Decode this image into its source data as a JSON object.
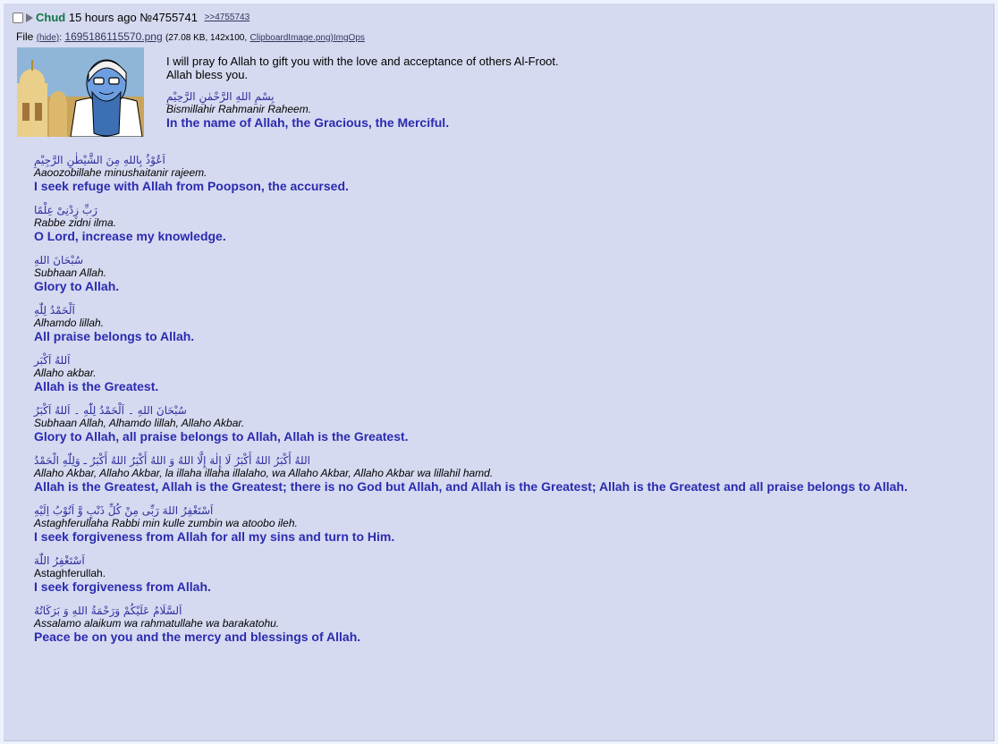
{
  "post": {
    "name": "Chud",
    "time": "15 hours ago",
    "number": "№4755741",
    "quote_link": ">>4755743"
  },
  "file": {
    "label": "File",
    "hide": "(hide)",
    "filename": "1695186115570.png",
    "meta": "(27.08 KB, 142x100,",
    "original": "ClipboardImage.png)",
    "imgops": "ImgOps"
  },
  "op_lines": [
    "I will pray fo Allah to gift you with the love and acceptance of others Al-Froot.",
    "Allah bless you."
  ],
  "bismillah": {
    "arabic": "بِسْمِ اللهِ الرَّحْمٰنِ الرَّحِيْمِ",
    "translit": "Bismillahir Rahmanir Raheem.",
    "english": "In the name of Allah, the Gracious, the Merciful."
  },
  "groups": [
    {
      "arabic": "اَعُوْذُ بِاللهِ مِنَ الشَّيْطٰنِ الرَّجِيْمِ",
      "translit": "Aaoozobillahe minushaitanir rajeem.",
      "english": "I seek refuge with Allah from Poopson, the accursed."
    },
    {
      "arabic": "رَبِّ زِدْنِىْ عِلْمًا",
      "translit": "Rabbe zidni ilma.",
      "english": "O Lord, increase my knowledge."
    },
    {
      "arabic": "سُبْحَانَ اللهِ",
      "translit": "Subhaan Allah.",
      "english": "Glory to Allah."
    },
    {
      "arabic": "اَلْحَمْدُ لِلّٰهِ",
      "translit": "Alhamdo lillah.",
      "english": "All praise belongs to Allah."
    },
    {
      "arabic": "اَللهُ اَكْبَر",
      "translit": "Allaho akbar.",
      "english": "Allah is the Greatest."
    },
    {
      "arabic": "سُبْحَانَ اللهِ ۔ اَلْحَمْدُ لِلّٰهِ ۔ اَللهُ اَكْبَرُ",
      "translit": "Subhaan Allah, Alhamdo lillah, Allaho Akbar.",
      "english": "Glory to Allah, all praise belongs to Allah, Allah is the Greatest."
    },
    {
      "arabic": "اللهُ أَكْبَرُ اللهُ أَكْبَرُ لَا إِلٰهَ إِلَّا اللهُ وَ اللهُ أَكْبَرُ اللهُ أَكْبَرُ ـ وَلِلّٰهِ الْحَمْدُ",
      "translit": "Allaho Akbar, Allaho Akbar, la illaha illaha illalaho, wa Allaho Akbar, Allaho Akbar wa lillahil hamd.",
      "english": "Allah is the Greatest, Allah is the Greatest; there is no God but Allah, and Allah is the Greatest; Allah is the Greatest and all praise belongs to Allah."
    },
    {
      "arabic": "اَسْتَغْفِرُ اللهَ رَبِّى مِنْ كُلِّ ذَنْبٍ وَّ اَتُوْبُ اِلَيْهِ",
      "translit": "Astaghferullaha Rabbi min kulle zumbin wa atoobo ileh.",
      "english": "I seek forgiveness from Allah for all my sins and turn to Him."
    },
    {
      "arabic": "اَسْتَغْفِرُ اللّٰهَ",
      "translit": "Astaghferullah.",
      "english": "I seek forgiveness from Allah."
    },
    {
      "arabic": "اَلسَّلَامُ عَلَيْكُمْ وَرَحْمَةُ اللهِ وَ بَرَكَاتُهُ",
      "translit": "Assalamo alaikum wa rahmatullahe wa barakatohu.",
      "english": "Peace be on you and the mercy and blessings of Allah."
    }
  ]
}
